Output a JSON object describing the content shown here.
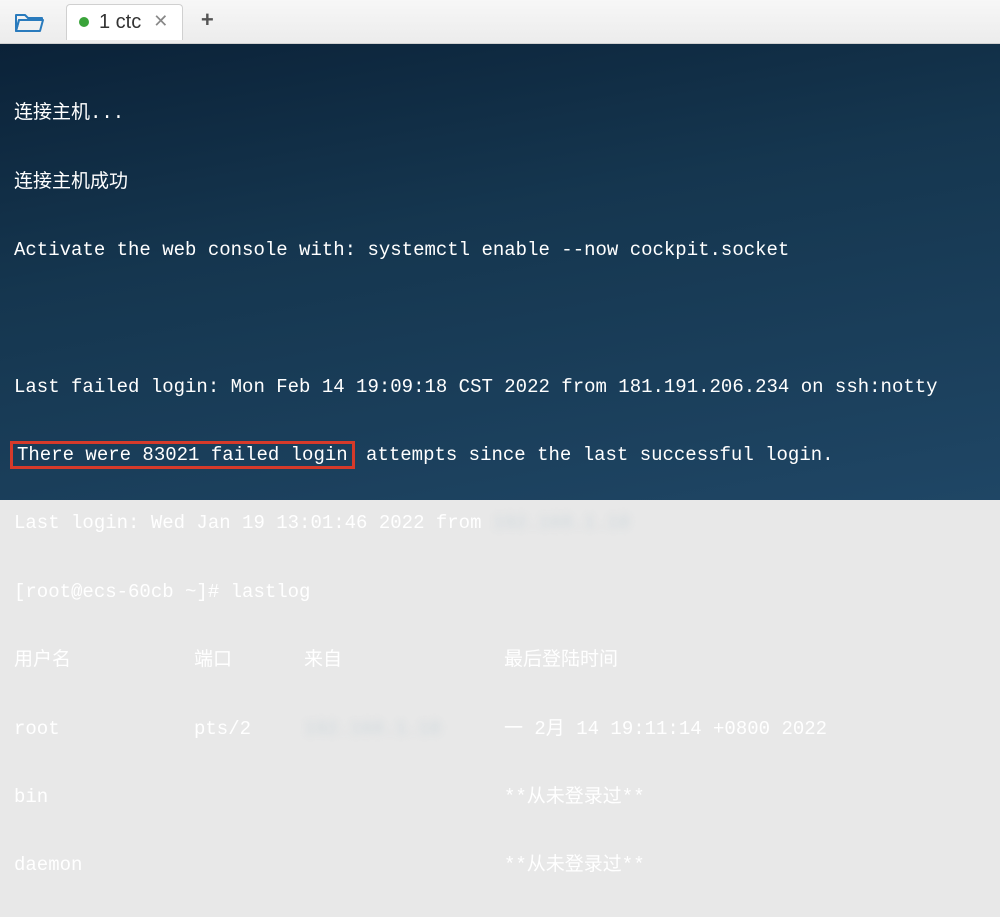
{
  "tabbar": {
    "active_tab_label": "1 ctc"
  },
  "terminal": {
    "line_connecting": "连接主机...",
    "line_connected": "连接主机成功",
    "line_activate": "Activate the web console with: systemctl enable --now cockpit.socket",
    "line_last_failed": "Last failed login: Mon Feb 14 19:09:18 CST 2022 from 181.191.206.234 on ssh:notty",
    "failed_login_prefix": "There were 83021 failed login",
    "failed_login_suffix": " attempts since the last successful login.",
    "last_login_prefix": "Last login: Wed Jan 19 13:01:46 2022 from ",
    "last_login_blur": "192.168.1.10",
    "prompt": "[root@ecs-60cb ~]# ",
    "command": "lastlog",
    "headers": {
      "user": "用户名",
      "port": "端口",
      "from": "来自",
      "time": "最后登陆时间"
    },
    "rows": [
      {
        "user": "root",
        "port": "pts/2",
        "from_blur": "192.168.1.10",
        "time": "一 2月 14 19:11:14 +0800 2022"
      },
      {
        "user": "bin",
        "port": "",
        "from_blur": "",
        "time": "**从未登录过**"
      },
      {
        "user": "daemon",
        "port": "",
        "from_blur": "",
        "time": "**从未登录过**"
      }
    ]
  }
}
